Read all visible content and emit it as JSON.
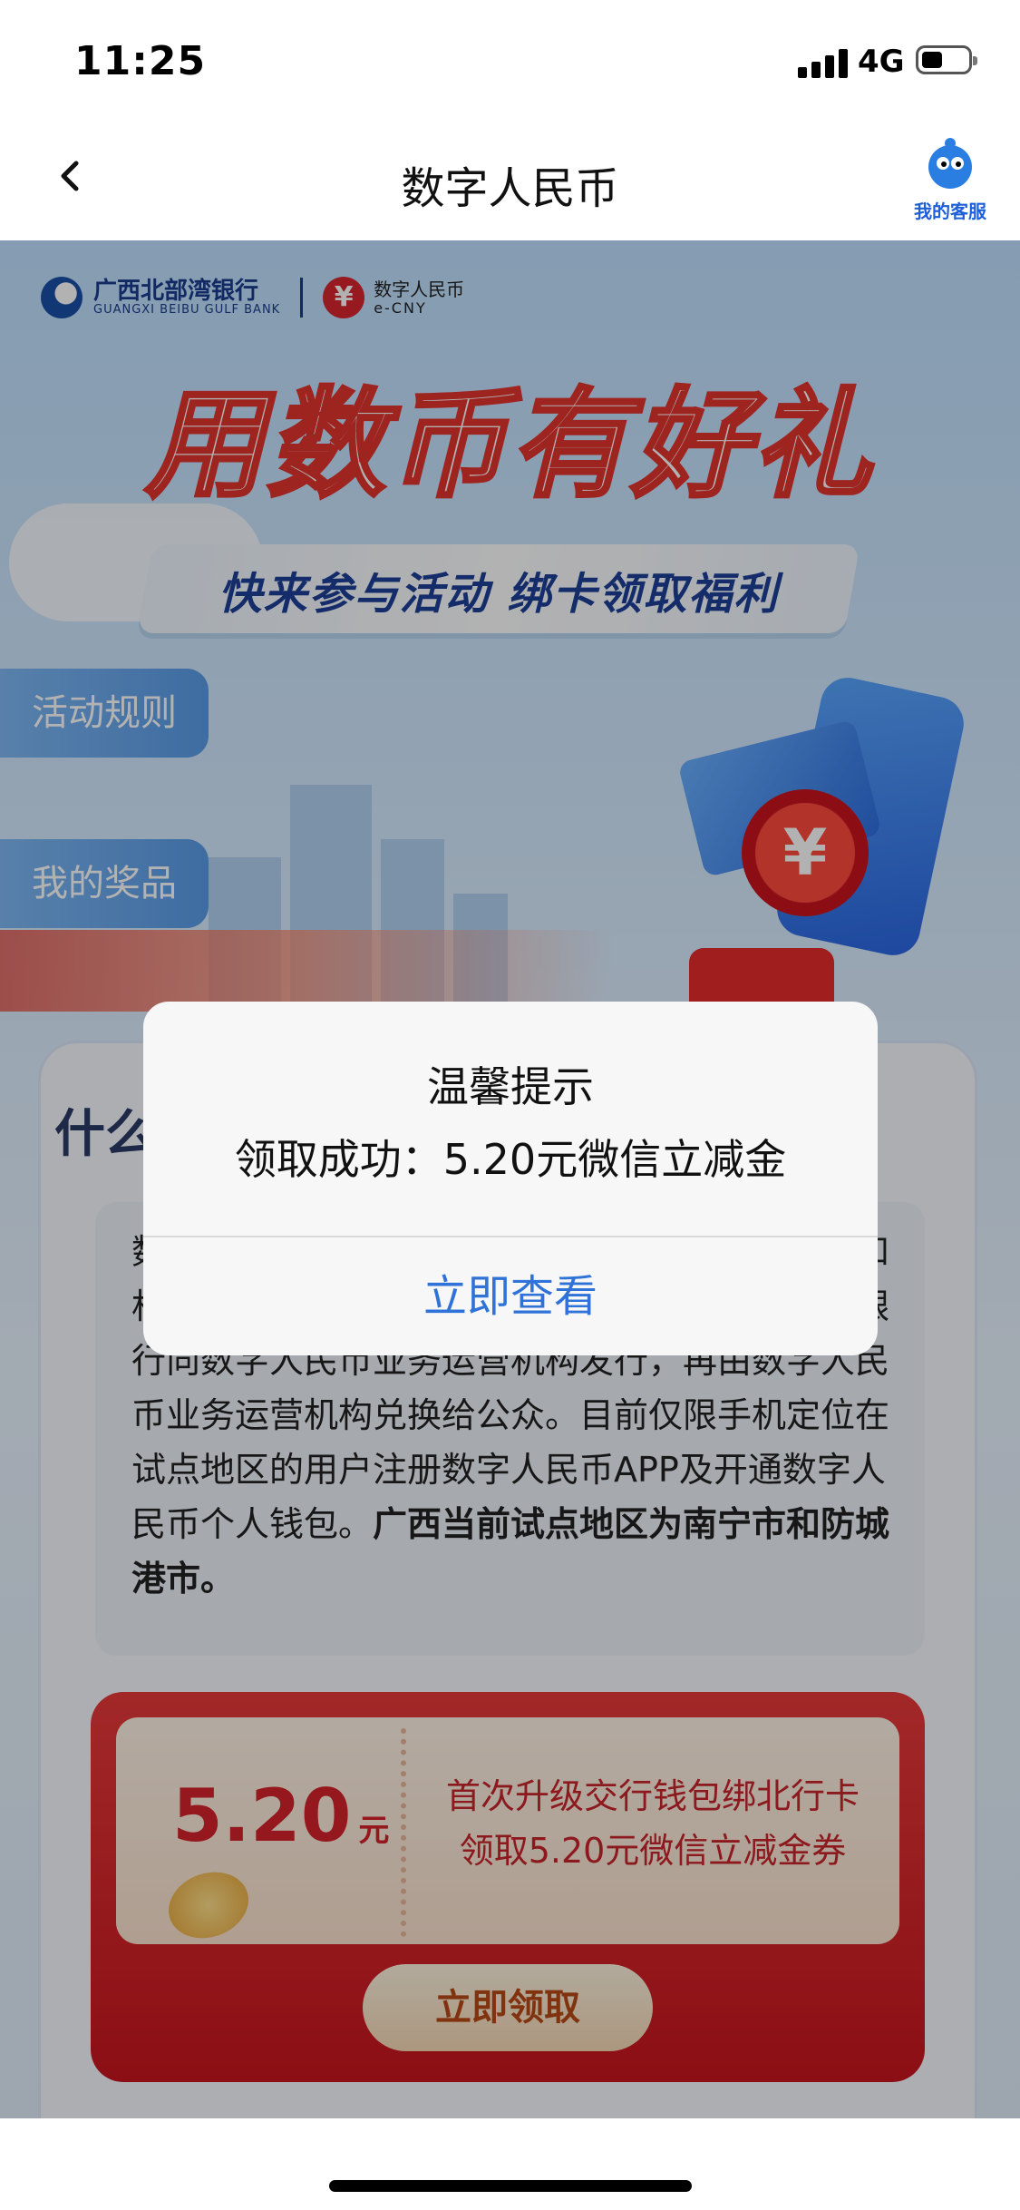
{
  "status_bar": {
    "time": "11:25",
    "network": "4G"
  },
  "nav": {
    "title": "数字人民币",
    "service_label": "我的客服"
  },
  "bank": {
    "name_cn": "广西北部湾银行",
    "name_en": "GUANGXI BEIBU GULF BANK",
    "ecny_cn": "数字人民币",
    "ecny_en": "e-CNY",
    "ecny_symbol": "¥"
  },
  "banner": {
    "headline": "用数币有好礼",
    "subtitle": "快来参与活动  绑卡领取福利"
  },
  "side_tabs": {
    "rules": "活动规则",
    "prizes": "我的奖品"
  },
  "info": {
    "title": "什么是数字人民币",
    "body": "数字人民币是中国人民银行发行的法定数字货币和相关支付体系，采用双层运营架构，由中国人民银行向数字人民币业务运营机构发行，再由数字人民币业务运营机构兑换给公众。目前仅限手机定位在试点地区的用户注册数字人民币APP及开通数字人民币个人钱包。",
    "body_bold": "广西当前试点地区为南宁市和防城港市。"
  },
  "coupon": {
    "amount": "5.20",
    "unit": "元",
    "desc_line1": "首次升级交行钱包绑北行卡",
    "desc_line2": "领取5.20元微信立减金券",
    "button": "立即领取"
  },
  "dialog": {
    "title": "温馨提示",
    "message": "领取成功：5.20元微信立减金",
    "button": "立即查看"
  },
  "colors": {
    "accent_blue": "#2f73d9",
    "brand_red": "#d4232a",
    "nav_text": "#111111"
  }
}
